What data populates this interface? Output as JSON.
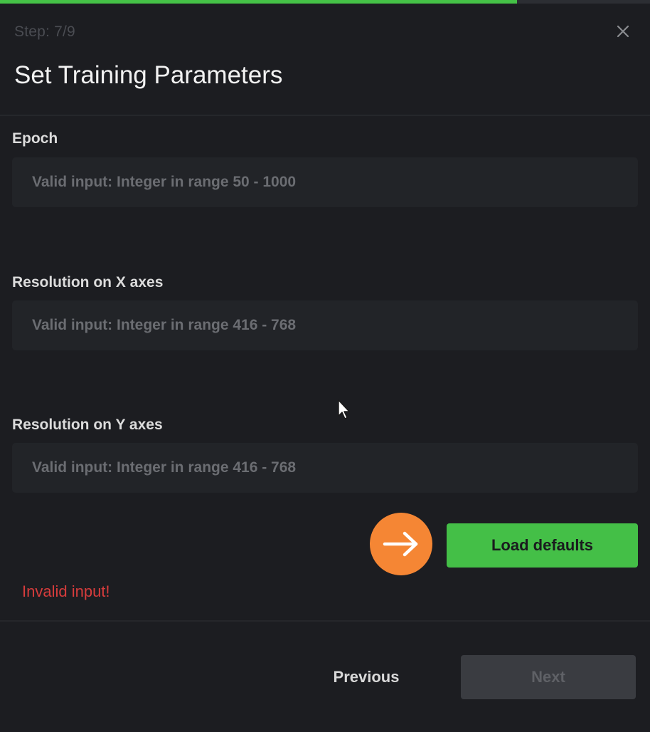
{
  "progress": {
    "step_text": "Step: 7/9",
    "fraction": 0.795,
    "color": "#45c247"
  },
  "dialog": {
    "title": "Set Training Parameters",
    "close_icon": "close-icon"
  },
  "fields": [
    {
      "label": "Epoch",
      "value": "",
      "placeholder": "Valid input: Integer in range 50 - 1000"
    },
    {
      "label": "Resolution on X axes",
      "value": "",
      "placeholder": "Valid input: Integer in range 416 - 768"
    },
    {
      "label": "Resolution on Y axes",
      "value": "",
      "placeholder": "Valid input: Integer in range 416 - 768"
    }
  ],
  "actions": {
    "hint_icon": "arrow-right-icon",
    "load_defaults_label": "Load defaults",
    "accent_color": "#44bf47",
    "hint_color": "#f58634"
  },
  "error": {
    "message": "Invalid input!",
    "color": "#d63c3c"
  },
  "footer": {
    "previous_label": "Previous",
    "next_label": "Next",
    "next_disabled": true
  }
}
